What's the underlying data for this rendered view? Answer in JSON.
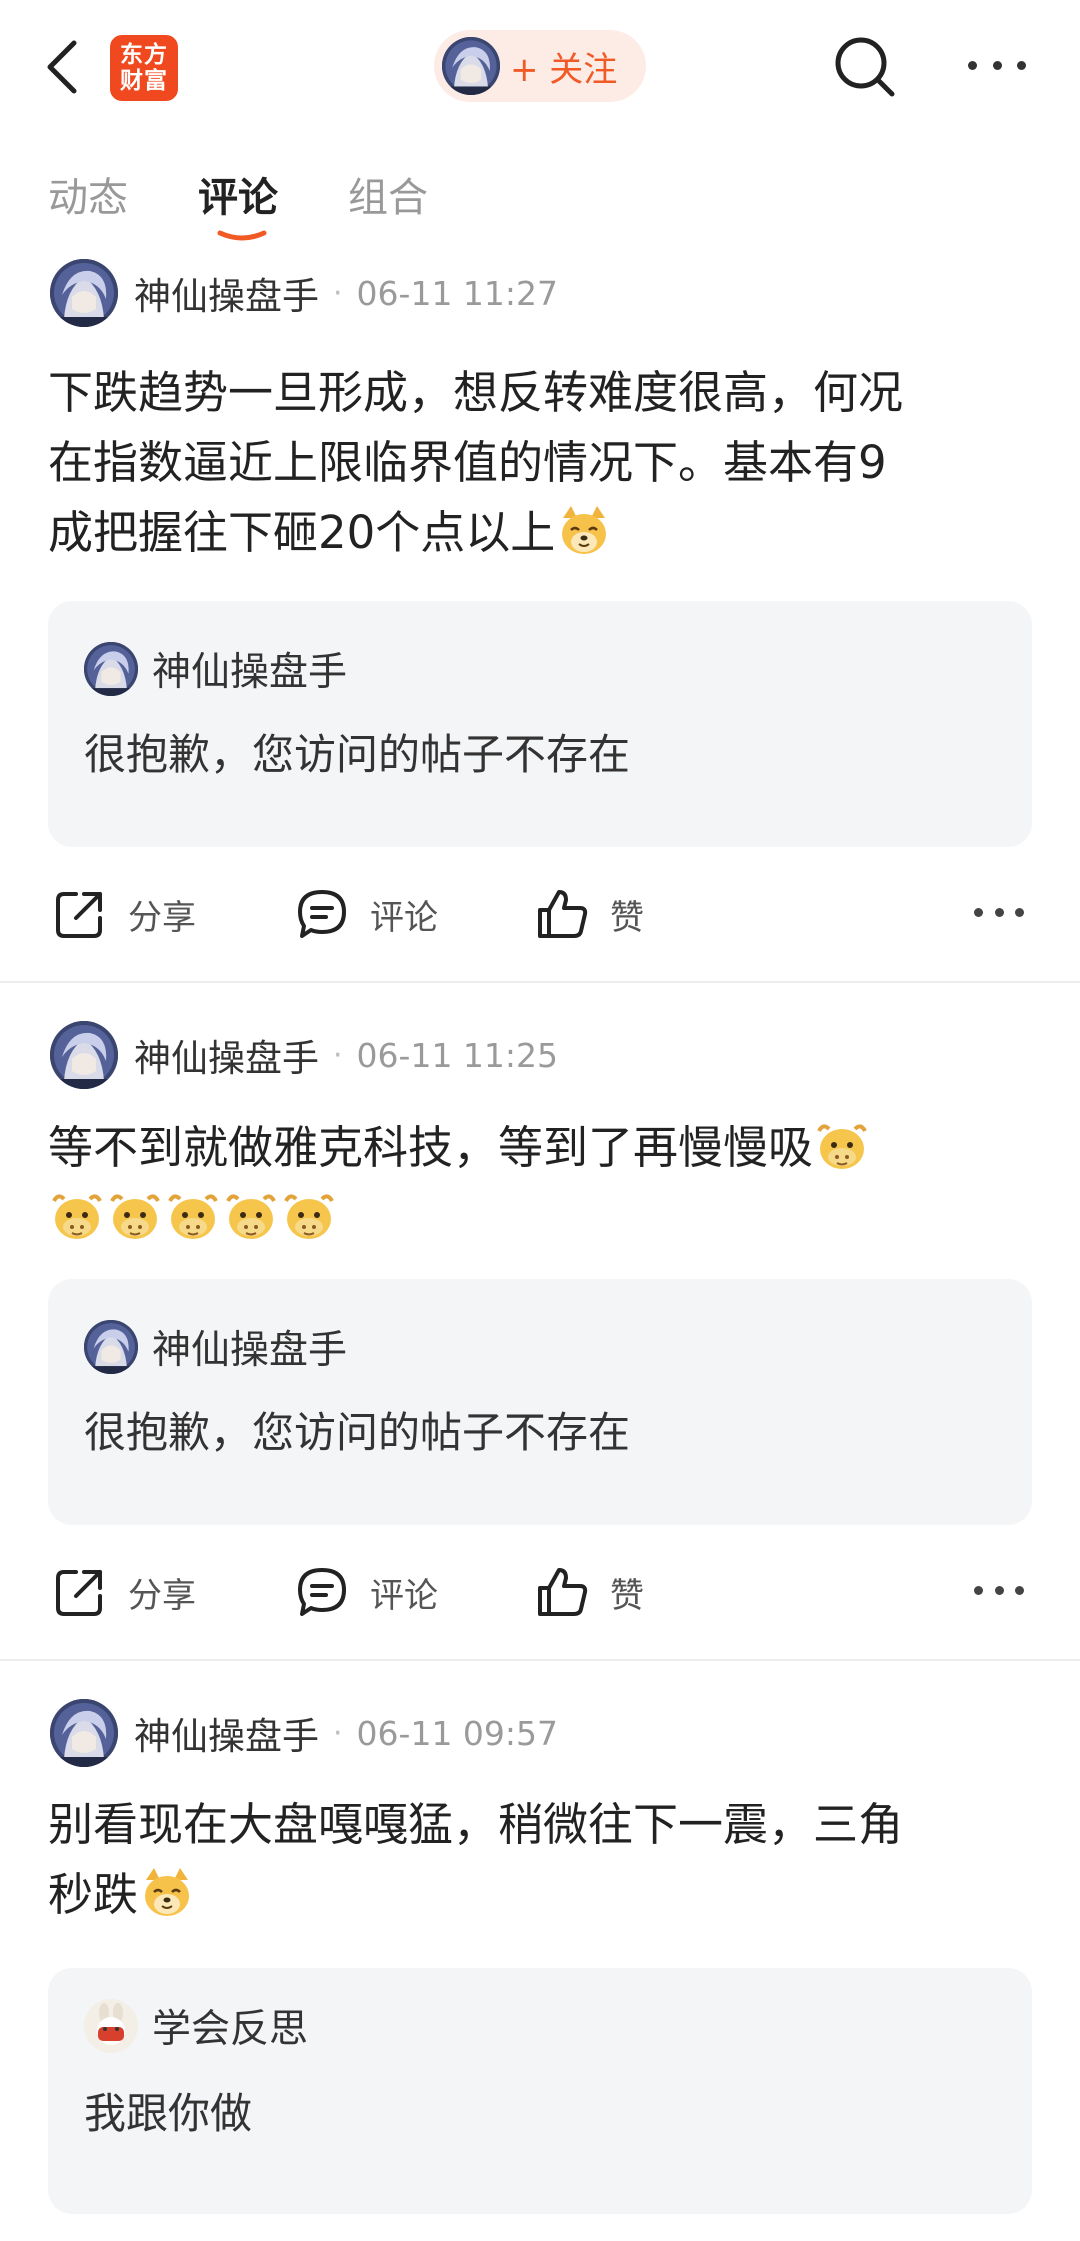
{
  "header": {
    "logo_line1": "东方",
    "logo_line2": "财富",
    "follow_label": "+ 关注",
    "brand_color": "#f0491f",
    "accent_color": "#f15a24"
  },
  "tabs": [
    {
      "label": "动态",
      "active": false
    },
    {
      "label": "评论",
      "active": true
    },
    {
      "label": "组合",
      "active": false
    }
  ],
  "posts": [
    {
      "username": "神仙操盘手",
      "dot": "·",
      "time": "06-11 11:27",
      "text_lines": [
        "下跌趋势一旦形成，想反转难度很高，何况",
        "在指数逼近上限临界值的情况下。基本有9",
        "成把握往下砸20个点以上"
      ],
      "trailing_emoji": "dog-emoji",
      "quote": {
        "username": "神仙操盘手",
        "text": "很抱歉，您访问的帖子不存在"
      },
      "actions": {
        "share": "分享",
        "comment": "评论",
        "like": "赞"
      }
    },
    {
      "username": "神仙操盘手",
      "dot": "·",
      "time": "06-11 11:25",
      "text_lines": [
        "等不到就做雅克科技，等到了再慢慢吸"
      ],
      "trailing_emoji": "ox-emoji",
      "emoji_row_count": 5,
      "quote": {
        "username": "神仙操盘手",
        "text": "很抱歉，您访问的帖子不存在"
      },
      "actions": {
        "share": "分享",
        "comment": "评论",
        "like": "赞"
      }
    },
    {
      "username": "神仙操盘手",
      "dot": "·",
      "time": "06-11 09:57",
      "text_lines": [
        "别看现在大盘嘎嘎猛，稍微往下一震，三角",
        "秒跌"
      ],
      "trailing_emoji": "dog-emoji",
      "quote": {
        "username": "学会反思",
        "text": "我跟你做"
      }
    }
  ]
}
